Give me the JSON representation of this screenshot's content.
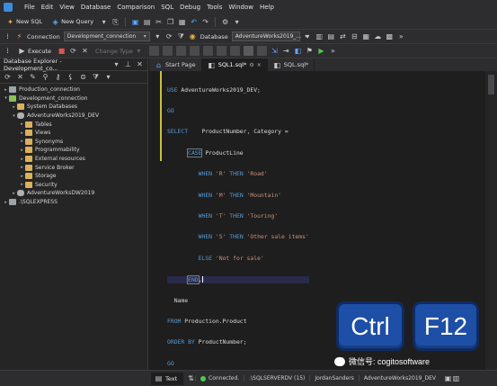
{
  "menubar": {
    "items": [
      "File",
      "Edit",
      "View",
      "Database",
      "Comparison",
      "SQL",
      "Debug",
      "Tools",
      "Window",
      "Help"
    ]
  },
  "toolbar1": {
    "new_sql": "New SQL",
    "new_query": "New Query"
  },
  "toolbar2": {
    "connection_label": "Connection",
    "connection_value": "Development_connection",
    "database_label": "Database",
    "database_value": "AdventureWorks2019_..."
  },
  "toolbar3": {
    "execute": "Execute",
    "change_type": "Change Type"
  },
  "explorer": {
    "title": "Database Explorer - Development_co...",
    "tree": [
      {
        "label": "Production_connection",
        "level": 0,
        "icon": "server-icon",
        "toggle": "▸"
      },
      {
        "label": "Development_connection",
        "level": 0,
        "icon": "server-icon",
        "toggle": "▾"
      },
      {
        "label": "System Databases",
        "level": 1,
        "icon": "folder-icon",
        "toggle": "▸"
      },
      {
        "label": "AdventureWorks2019_DEV",
        "level": 1,
        "icon": "database-icon",
        "toggle": "▾"
      },
      {
        "label": "Tables",
        "level": 2,
        "icon": "folder-icon",
        "toggle": "▸"
      },
      {
        "label": "Views",
        "level": 2,
        "icon": "folder-icon",
        "toggle": "▸"
      },
      {
        "label": "Synonyms",
        "level": 2,
        "icon": "folder-icon",
        "toggle": "▸"
      },
      {
        "label": "Programmability",
        "level": 2,
        "icon": "folder-icon",
        "toggle": "▸"
      },
      {
        "label": "External resources",
        "level": 2,
        "icon": "folder-icon",
        "toggle": "▸"
      },
      {
        "label": "Service Broker",
        "level": 2,
        "icon": "folder-icon",
        "toggle": "▸"
      },
      {
        "label": "Storage",
        "level": 2,
        "icon": "folder-icon",
        "toggle": "▸"
      },
      {
        "label": "Security",
        "level": 2,
        "icon": "folder-icon",
        "toggle": "▸"
      },
      {
        "label": "AdventureWorksDW2019",
        "level": 1,
        "icon": "database-icon",
        "toggle": "▸"
      },
      {
        "label": ".\\SQLEXPRESS",
        "level": 0,
        "icon": "server-icon",
        "toggle": "▸"
      }
    ]
  },
  "tabs": [
    {
      "label": "Start Page",
      "active": false
    },
    {
      "label": "SQL1.sql*",
      "active": true
    },
    {
      "label": "SQL.sql*",
      "active": false
    }
  ],
  "code": {
    "line1_kw": "USE",
    "line1_rest": " AdventureWorks2019_DEV;",
    "line2": "GO",
    "line3_kw": "SELECT",
    "line3_rest": "    ProductNumber, Category =",
    "line4_kw1": "CASE",
    "line4_rest": " ProductLine",
    "when_kw": "WHEN",
    "then_kw": "THEN",
    "w1_val": "'R'",
    "w1_res": "'Road'",
    "w2_val": "'M'",
    "w2_res": "'Mountain'",
    "w3_val": "'T'",
    "w3_res": "'Touring'",
    "w4_val": "'S'",
    "w4_res": "'Other sale items'",
    "else_kw": "ELSE",
    "else_res": "'Not for sale'",
    "end_kw": "END",
    "end_rest": ",",
    "name_line": "Name",
    "from_kw": "FROM",
    "from_rest": " Production.Product",
    "order_kw": "ORDER BY",
    "order_rest": " ProductNumber;",
    "last": "GO"
  },
  "overlay": {
    "key1": "Ctrl",
    "key2": "F12",
    "watermark": "微信号: cogitosoftware"
  },
  "status": {
    "text_tab": "Text",
    "connection": "Connected.",
    "server": ".\\SQLSERVERDV (15)",
    "user": "JordanSanders",
    "database": "AdventureWorks2019_DEV"
  }
}
